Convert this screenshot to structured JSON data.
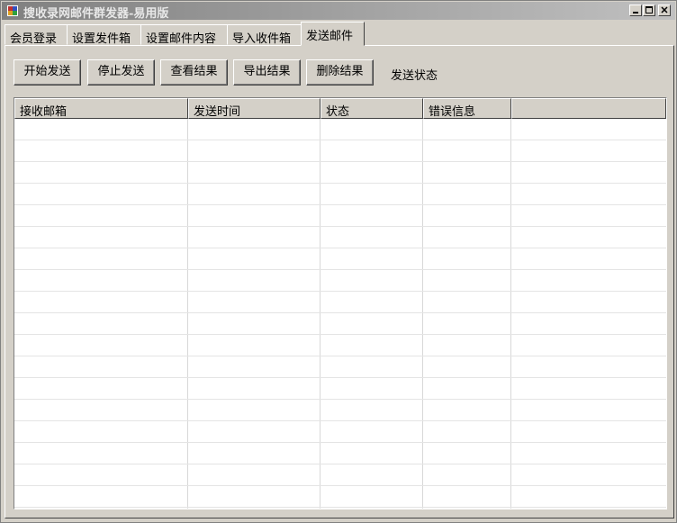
{
  "window": {
    "title": "搜收录网邮件群发器-易用版",
    "controls": {
      "minimize": "_",
      "maximize": "□",
      "close": "×"
    }
  },
  "tabs": [
    {
      "label": "会员登录"
    },
    {
      "label": "设置发件箱"
    },
    {
      "label": "设置邮件内容"
    },
    {
      "label": "导入收件箱"
    },
    {
      "label": "发送邮件"
    }
  ],
  "active_tab": "发送邮件",
  "toolbar": {
    "start": "开始发送",
    "stop": "停止发送",
    "view": "查看结果",
    "export": "导出结果",
    "delete": "删除结果",
    "status_label": "发送状态"
  },
  "table": {
    "columns": [
      "接收邮箱",
      "发送时间",
      "状态",
      "错误信息",
      ""
    ],
    "rows": []
  }
}
